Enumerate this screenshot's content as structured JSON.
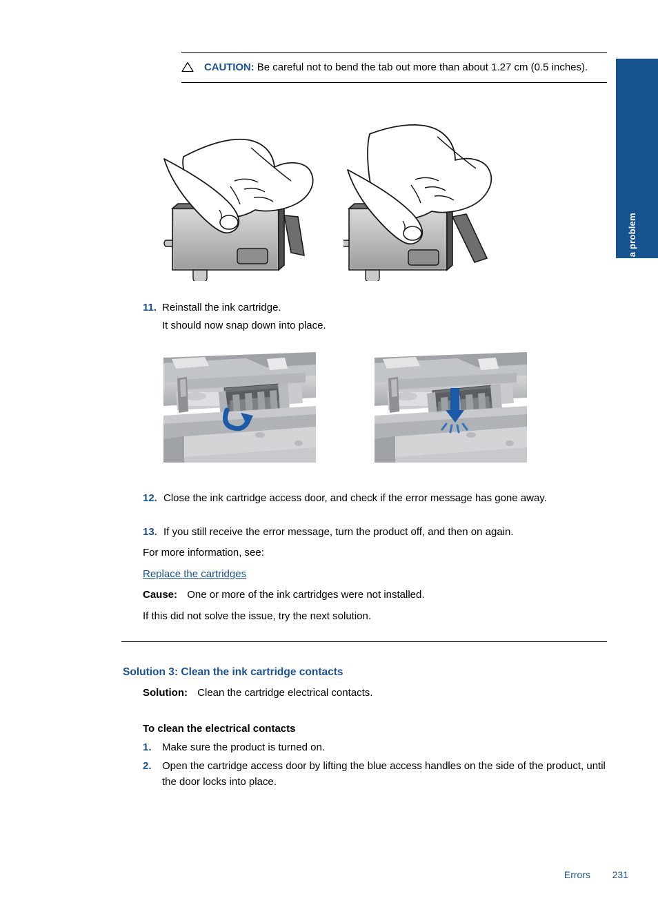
{
  "side_tab": {
    "label": "Solve a problem",
    "color": "#16528f"
  },
  "caution": {
    "icon": "warning-triangle-icon",
    "label": "CAUTION:",
    "text": "Be careful not to bend the tab out more than about 1.27 cm (0.5 inches)."
  },
  "figures": {
    "tab_bend_pair": {
      "left_caption": "",
      "right_caption": "",
      "description": "Hand bending the cartridge tab outward"
    },
    "carriage_pair": {
      "left_description": "Ink cartridge being rotated into carriage, curved blue arrow",
      "right_description": "Ink cartridge pressed down into carriage, straight blue arrow"
    }
  },
  "steps_continued": [
    {
      "number": "11.",
      "text": "Reinstall the ink cartridge.",
      "sub": "It should now snap down into place."
    },
    {
      "number": "12.",
      "text": "Close the ink cartridge access door, and check if the error message has gone away."
    },
    {
      "number": "13.",
      "text": "If you still receive the error message, turn the product off, and then on again."
    }
  ],
  "more_info": {
    "label": "For more information, see:",
    "link": "Replace the cartridges"
  },
  "cause": {
    "label": "Cause:",
    "text": "One or more of the ink cartridges were not installed."
  },
  "next_solution_note": "If this did not solve the issue, try the next solution.",
  "solution3": {
    "heading": "Solution 3: Clean the ink cartridge contacts",
    "solution_label": "Solution:",
    "solution_text": "Clean the cartridge electrical contacts.",
    "procedure_heading": "To clean the electrical contacts",
    "steps": [
      {
        "number": "1.",
        "text": "Make sure the product is turned on."
      },
      {
        "number": "2.",
        "text": "Open the cartridge access door by lifting the blue access handles on the side of the product, until the door locks into place."
      }
    ]
  },
  "footer": {
    "chapter": "Errors",
    "page": "231",
    "color": "#1a5296"
  }
}
